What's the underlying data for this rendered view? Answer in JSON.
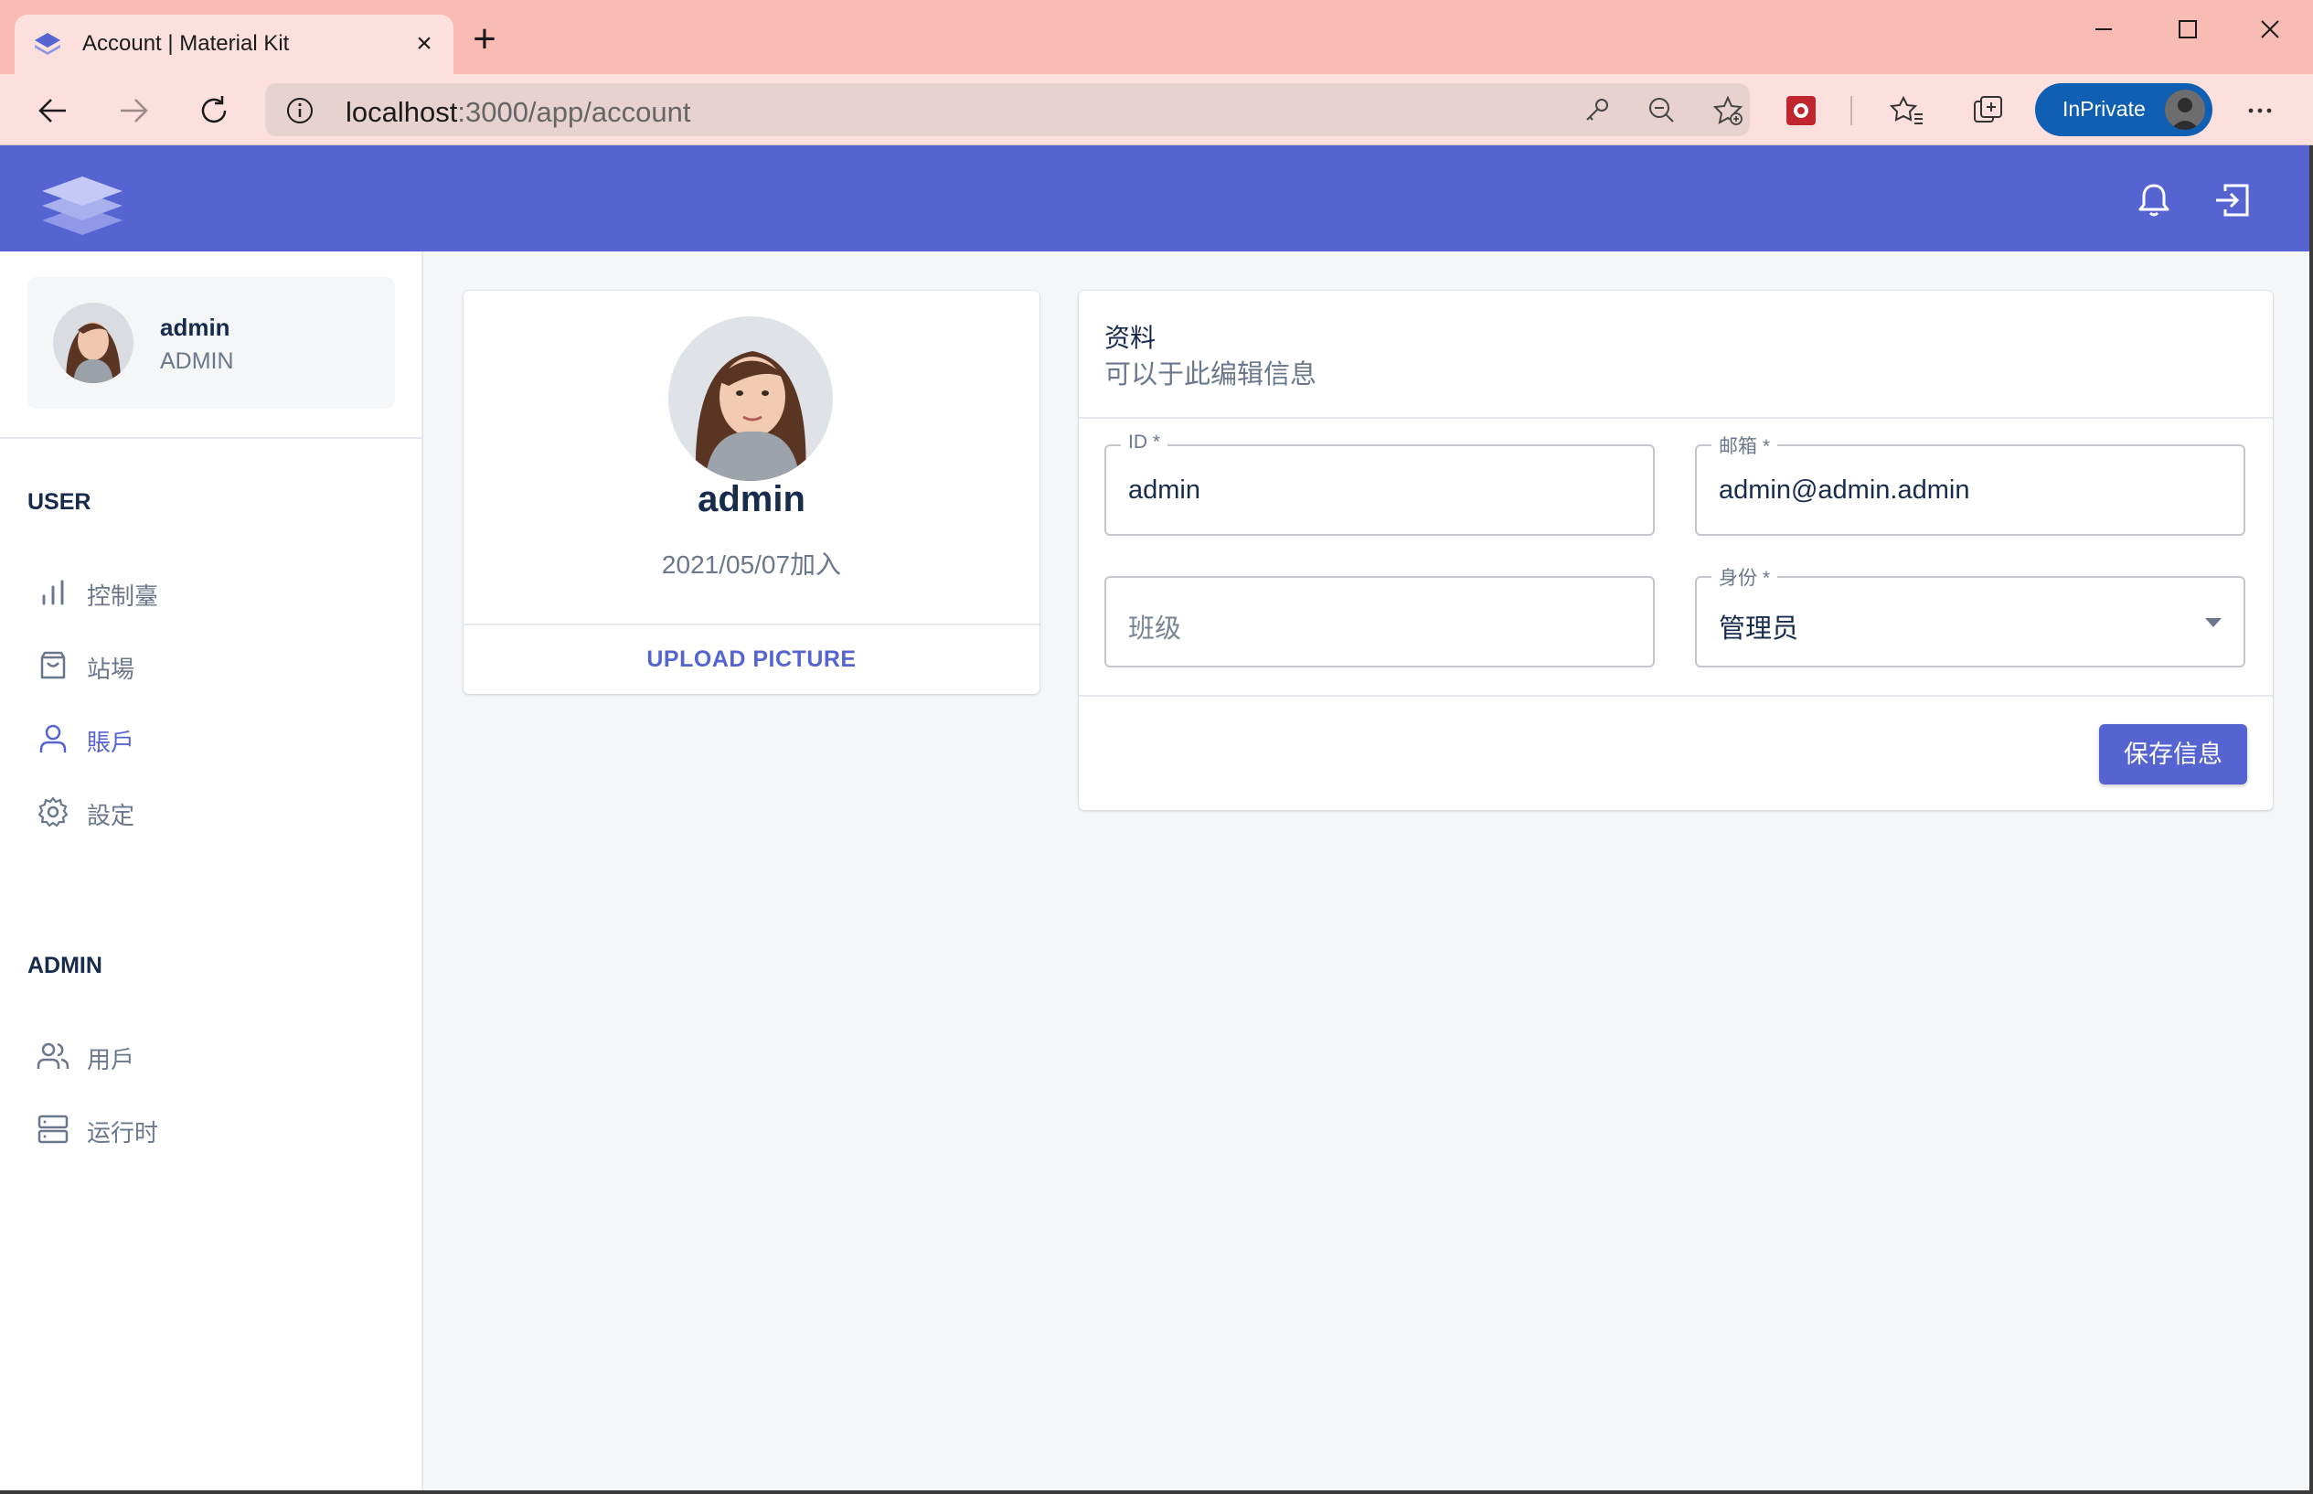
{
  "browser": {
    "tab_title": "Account | Material Kit",
    "url_host": "localhost",
    "url_rest": ":3000/app/account",
    "inprivate_label": "InPrivate",
    "frame_color": "#f9bcb4"
  },
  "appbar": {
    "color": "#5664d2",
    "icons": [
      "logo-icon",
      "bell-icon",
      "logout-icon"
    ]
  },
  "sidebar": {
    "user": {
      "name": "admin",
      "role": "ADMIN"
    },
    "sections": [
      {
        "label": "USER",
        "items": [
          {
            "label": "控制臺",
            "icon": "bar-chart-icon",
            "active": false
          },
          {
            "label": "站場",
            "icon": "shopping-bag-icon",
            "active": false
          },
          {
            "label": "賬戶",
            "icon": "user-icon",
            "active": true
          },
          {
            "label": "設定",
            "icon": "settings-icon",
            "active": false
          }
        ]
      },
      {
        "label": "ADMIN",
        "items": [
          {
            "label": "用戶",
            "icon": "users-icon",
            "active": false
          },
          {
            "label": "运行时",
            "icon": "server-icon",
            "active": false
          }
        ]
      }
    ]
  },
  "profile": {
    "name": "admin",
    "joined": "2021/05/07加入",
    "upload_label": "UPLOAD PICTURE"
  },
  "details": {
    "title": "资料",
    "subtitle": "可以于此编辑信息",
    "fields": {
      "id": {
        "label": "ID *",
        "value": "admin"
      },
      "email": {
        "label": "邮箱 *",
        "value": "admin@admin.admin"
      },
      "class": {
        "placeholder": "班级"
      },
      "role": {
        "label": "身份 *",
        "value": "管理员"
      }
    },
    "save_label": "保存信息"
  },
  "colors": {
    "primary": "#5664d2",
    "text": "#172b4d",
    "muted": "#6b778c",
    "background": "#f4f6f8"
  }
}
